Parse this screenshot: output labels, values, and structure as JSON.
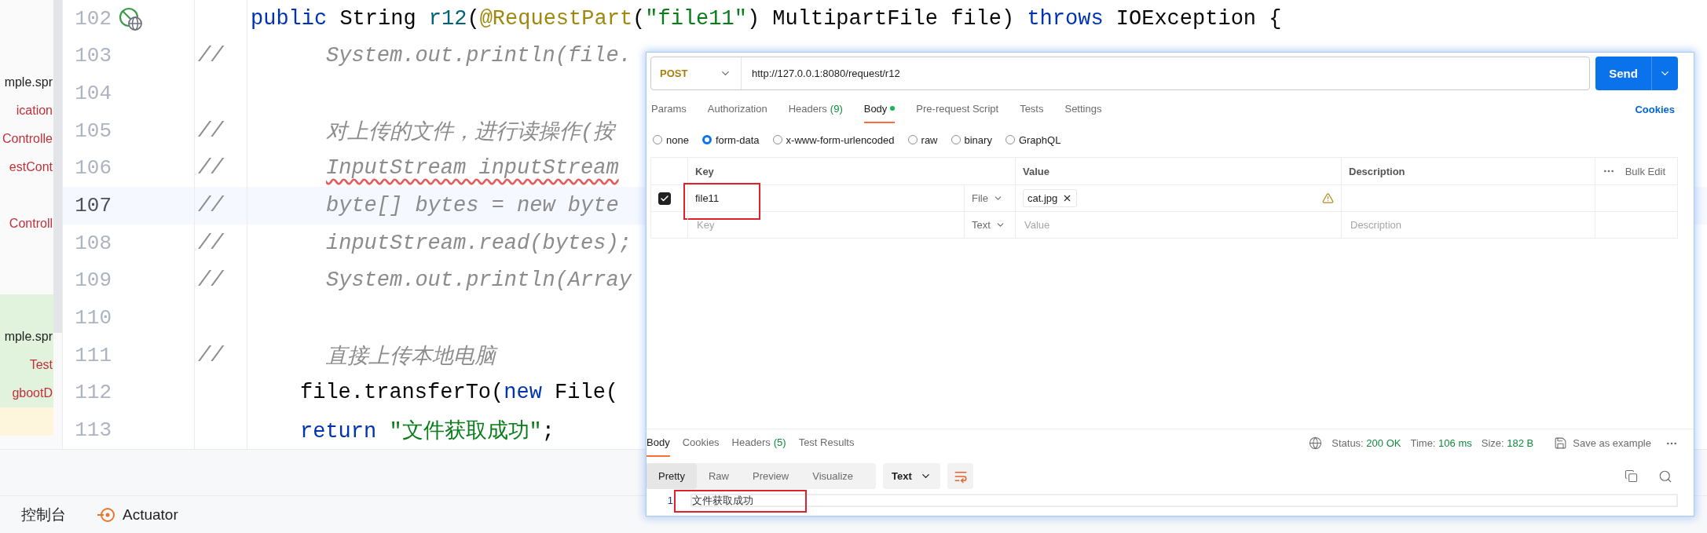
{
  "project_tree": [
    {
      "kind": "entry",
      "text": "mple.spr",
      "color": "#1f1f1f",
      "added": false,
      "changed": false
    },
    {
      "kind": "entry",
      "text": "ication",
      "color": "#c0303a",
      "added": false,
      "changed": false
    },
    {
      "kind": "entry",
      "text": "Controlle",
      "color": "#c0303a",
      "added": false,
      "changed": false
    },
    {
      "kind": "entry",
      "text": "estCont",
      "color": "#c0303a",
      "added": false,
      "changed": false
    },
    {
      "kind": "blank",
      "added": false,
      "changed": false
    },
    {
      "kind": "entry",
      "text": "Controll",
      "color": "#c0303a",
      "added": false,
      "changed": false
    },
    {
      "kind": "blank",
      "added": false,
      "changed": false
    },
    {
      "kind": "blank",
      "added": false,
      "changed": false
    },
    {
      "kind": "blank",
      "added": true,
      "changed": false
    },
    {
      "kind": "entry",
      "text": "mple.spr",
      "color": "#1f1f1f",
      "added": true,
      "changed": false
    },
    {
      "kind": "entry",
      "text": "Test",
      "color": "#c0303a",
      "added": true,
      "changed": false
    },
    {
      "kind": "entry",
      "text": "gbootD",
      "color": "#c0303a",
      "added": true,
      "changed": false
    },
    {
      "kind": "blank",
      "added": false,
      "changed": true
    }
  ],
  "code_lines": [
    {
      "number": "102",
      "kind": "signature",
      "current": false,
      "gutter_icon": true,
      "tokens": [
        {
          "kind": "keyword",
          "text": "public"
        },
        {
          "kind": "plain",
          "text": " String "
        },
        {
          "kind": "method",
          "text": "r12"
        },
        {
          "kind": "plain",
          "text": "("
        },
        {
          "kind": "annotation",
          "text": "@RequestPart"
        },
        {
          "kind": "plain",
          "text": "("
        },
        {
          "kind": "string",
          "text": "\"file11\""
        },
        {
          "kind": "plain",
          "text": ") MultipartFile file) "
        },
        {
          "kind": "keyword",
          "text": "throws"
        },
        {
          "kind": "plain",
          "text": " IOException {"
        }
      ]
    },
    {
      "number": "103",
      "kind": "comment",
      "current": false,
      "comment": "//",
      "tokens": [
        {
          "kind": "comment",
          "text": "System.out.println(file.",
          "underlined": false
        }
      ]
    },
    {
      "number": "104",
      "current": false
    },
    {
      "number": "105",
      "kind": "comment",
      "current": false,
      "comment": "//",
      "tokens": [
        {
          "kind": "comment",
          "text": "对上传的文件，进行读操作(按",
          "underlined": false
        }
      ]
    },
    {
      "number": "106",
      "kind": "comment",
      "current": false,
      "comment": "//",
      "tokens": [
        {
          "kind": "comment",
          "text": "InputStream inputStream",
          "underlined": true
        }
      ]
    },
    {
      "number": "107",
      "kind": "comment",
      "current": true,
      "comment": "//",
      "tokens": [
        {
          "kind": "comment",
          "text": "byte[] bytes = new byte",
          "underlined": false
        }
      ]
    },
    {
      "number": "108",
      "kind": "comment",
      "current": false,
      "comment": "//",
      "tokens": [
        {
          "kind": "comment",
          "text": "inputStream.read(bytes);",
          "underlined": false
        }
      ]
    },
    {
      "number": "109",
      "kind": "comment",
      "current": false,
      "comment": "//",
      "tokens": [
        {
          "kind": "comment",
          "text": "System.out.println(Array",
          "underlined": false
        }
      ]
    },
    {
      "number": "110",
      "current": false
    },
    {
      "number": "111",
      "kind": "comment",
      "current": false,
      "comment": "//",
      "tokens": [
        {
          "kind": "comment",
          "text": "直接上传本地电脑",
          "underlined": false
        }
      ]
    },
    {
      "number": "112",
      "kind": "body",
      "current": false,
      "tokens": [
        {
          "kind": "plain",
          "text": "file.transferTo("
        },
        {
          "kind": "keyword",
          "text": "new"
        },
        {
          "kind": "plain",
          "text": " File("
        }
      ]
    },
    {
      "number": "113",
      "kind": "body",
      "current": false,
      "tokens": [
        {
          "kind": "keyword",
          "text": "return"
        },
        {
          "kind": "string",
          "text": " \"文件获取成功\""
        },
        {
          "kind": "plain",
          "text": ";"
        }
      ]
    }
  ],
  "bottom_tabs": [
    {
      "label": "控制台",
      "kind": "plain"
    },
    {
      "label": "Actuator",
      "kind": "with-icon"
    }
  ],
  "postman": {
    "request": {
      "method": "POST",
      "url": "http://127.0.0.1:8080/request/r12",
      "send": "Send"
    },
    "request_tabs": [
      {
        "label": "Params",
        "selected": false,
        "dot": false
      },
      {
        "label": "Authorization",
        "selected": false,
        "dot": false
      },
      {
        "label": "Headers",
        "count": "(9)",
        "selected": false,
        "dot": false
      },
      {
        "label": "Body",
        "selected": true,
        "dot": true
      },
      {
        "label": "Pre-request Script",
        "selected": false,
        "dot": false
      },
      {
        "label": "Tests",
        "selected": false,
        "dot": false
      },
      {
        "label": "Settings",
        "selected": false,
        "dot": false
      }
    ],
    "cookies_link": "Cookies",
    "body_types": [
      {
        "label": "none",
        "selected": false
      },
      {
        "label": "form-data",
        "selected": true
      },
      {
        "label": "x-www-form-urlencoded",
        "selected": false
      },
      {
        "label": "raw",
        "selected": false
      },
      {
        "label": "binary",
        "selected": false
      },
      {
        "label": "GraphQL",
        "selected": false
      }
    ],
    "form_table": {
      "columns": [
        "Key",
        "Value",
        "Description"
      ],
      "bulk_edit": "Bulk Edit",
      "rows": [
        {
          "kind": "entry",
          "checked": true,
          "key": "file11",
          "type": "File",
          "file": "cat.jpg",
          "warning": true,
          "framed": true
        },
        {
          "kind": "new",
          "key_placeholder": "Key",
          "type": "Text",
          "value_placeholder": "Value",
          "description_placeholder": "Description",
          "framed": false
        }
      ]
    },
    "response": {
      "tabs": [
        {
          "label": "Body",
          "selected": true
        },
        {
          "label": "Cookies",
          "selected": false
        },
        {
          "label": "Headers",
          "count": "(5)",
          "selected": false
        },
        {
          "label": "Test Results",
          "selected": false
        }
      ],
      "status_label": "Status:",
      "status": "200 OK",
      "time_label": "Time:",
      "time": "106 ms",
      "size_label": "Size:",
      "size": "182 B",
      "save": "Save as example",
      "views": [
        {
          "label": "Pretty",
          "selected": true
        },
        {
          "label": "Raw",
          "selected": false
        },
        {
          "label": "Preview",
          "selected": false
        },
        {
          "label": "Visualize",
          "selected": false
        }
      ],
      "format": "Text",
      "lines": [
        {
          "number": "1",
          "text": "文件获取成功",
          "framed": true
        }
      ]
    }
  }
}
